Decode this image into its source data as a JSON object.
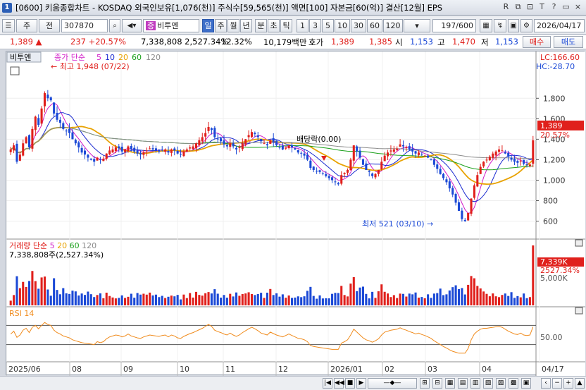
{
  "window": {
    "title": "[0600] 키움종합차트 - KOSDAQ 외국인보유[1,076(천)] 주식수[59,565(천)] 액면[100] 자본금[60(억)] 결산[12월] EPS",
    "controls": [
      "R",
      "⧉",
      "⊡",
      "T",
      "?",
      "▭",
      "×"
    ]
  },
  "toolbar": {
    "stock_type": "주",
    "market": "전",
    "code": "307870",
    "stock_name": "비투엔",
    "periods": [
      "일",
      "주",
      "월",
      "년",
      "분",
      "초",
      "틱"
    ],
    "selected_period": "일",
    "intervals": [
      "1",
      "3",
      "5",
      "10",
      "30",
      "60",
      "120"
    ],
    "count": "197/600",
    "date": "2026/04/17"
  },
  "quote": {
    "price": "1,389 ▲",
    "change": "237 +20.57%",
    "volume_amount": "7,338,808 2,527.34%",
    "turnover": "12.32%",
    "trade_value": "10,179백만",
    "ask_label": "호가",
    "ask": "1,389",
    "bid": "1,385",
    "open_label": "시",
    "open": "1,153",
    "high_label": "고",
    "high": "1,470",
    "low_label": "저",
    "low": "1,153",
    "buy_label": "매수",
    "sell_label": "매도"
  },
  "chart_legend": {
    "stock_name": "비투엔",
    "ma_label": "종가 단순",
    "ma_periods": [
      "5",
      "10",
      "20",
      "60",
      "120"
    ],
    "lc": "LC:166.60",
    "hc": "HC:-28.70",
    "vol_label": "거래량 단순",
    "vol_ma": [
      "5",
      "20",
      "60",
      "120"
    ],
    "vol_info": "7,338,808주(2,527.34%)",
    "rsi_label": "RSI 14",
    "annot_high": "최고 1,948 (07/22)",
    "annot_low": "최저 521 (03/10)",
    "annot_div": "배당락(0.00)",
    "price_tag": "1,389",
    "pct_tag": "20.57%",
    "vol_tag": "7,339K",
    "vol_pct_tag": "2527.34%"
  },
  "colors": {
    "up": "#e0201c",
    "down": "#1b49d6",
    "ma5": "#d21cc8",
    "ma10": "#1a2ad0",
    "ma20": "#e8a200",
    "ma60": "#1aa01a",
    "ma120": "#8c8c8c",
    "rsi": "#f08b1c"
  },
  "chart_data": {
    "type": "candlestick",
    "price_axis": {
      "ticks": [
        "1,800",
        "1,600",
        "1,400",
        "1,200",
        "1,000",
        "800",
        "600"
      ],
      "range": [
        480,
        2050
      ]
    },
    "volume_axis": {
      "ticks": [
        "5,000K"
      ]
    },
    "rsi_axis": {
      "ticks": [
        "50.00"
      ]
    },
    "x_ticks": [
      "2025/06",
      "08",
      "09",
      "10",
      "11",
      "12",
      "2026/01",
      "02",
      "03",
      "04",
      "04/17"
    ],
    "close_series": [
      1300,
      1340,
      1180,
      1250,
      1360,
      1420,
      1320,
      1500,
      1620,
      1540,
      1700,
      1850,
      1800,
      1780,
      1650,
      1590,
      1560,
      1500,
      1480,
      1460,
      1400,
      1360,
      1320,
      1270,
      1250,
      1220,
      1200,
      1180,
      1220,
      1200,
      1210,
      1260,
      1290,
      1300,
      1320,
      1310,
      1280,
      1300,
      1330,
      1300,
      1280,
      1260,
      1250,
      1270,
      1290,
      1310,
      1300,
      1290,
      1280,
      1290,
      1300,
      1270,
      1300,
      1290,
      1260,
      1250,
      1280,
      1300,
      1320,
      1330,
      1360,
      1390,
      1420,
      1460,
      1520,
      1490,
      1420,
      1400,
      1380,
      1350,
      1330,
      1360,
      1330,
      1300,
      1320,
      1360,
      1400,
      1440,
      1470,
      1450,
      1420,
      1380,
      1360,
      1340,
      1390,
      1370,
      1340,
      1320,
      1300,
      1320,
      1340,
      1320,
      1300,
      1270,
      1260,
      1240,
      1200,
      1120,
      1100,
      1090,
      1080,
      1060,
      1040,
      1020,
      1000,
      980,
      960,
      1050,
      1070,
      1100,
      1200,
      1340,
      1280,
      1220,
      1150,
      1100,
      1080,
      1040,
      1060,
      1100,
      1180,
      1240,
      1270,
      1290,
      1300,
      1310,
      1350,
      1330,
      1320,
      1300,
      1280,
      1260,
      1270,
      1250,
      1240,
      1220,
      1200,
      1150,
      1110,
      1060,
      1020,
      980,
      920,
      860,
      780,
      700,
      620,
      600,
      680,
      820,
      950,
      1050,
      1130,
      1180,
      1200,
      1230,
      1260,
      1280,
      1300,
      1290,
      1260,
      1230,
      1200,
      1180,
      1170,
      1190,
      1160,
      1150,
      1153,
      1389
    ],
    "rsi_series": [
      52,
      58,
      45,
      50,
      60,
      64,
      55,
      66,
      70,
      63,
      70,
      76,
      72,
      70,
      60,
      55,
      52,
      48,
      46,
      44,
      40,
      38,
      36,
      34,
      33,
      32,
      31,
      30,
      36,
      34,
      36,
      42,
      46,
      48,
      50,
      49,
      46,
      48,
      52,
      48,
      46,
      44,
      43,
      46,
      48,
      50,
      49,
      48,
      47,
      49,
      50,
      46,
      50,
      48,
      44,
      43,
      47,
      50,
      53,
      55,
      58,
      61,
      64,
      68,
      72,
      68,
      60,
      57,
      55,
      52,
      50,
      54,
      50,
      47,
      50,
      55,
      59,
      63,
      66,
      63,
      59,
      54,
      52,
      50,
      56,
      53,
      50,
      48,
      46,
      49,
      52,
      49,
      46,
      43,
      42,
      40,
      36,
      28,
      26,
      25,
      24,
      23,
      22,
      21,
      20,
      20,
      20,
      33,
      36,
      40,
      50,
      62,
      56,
      50,
      44,
      40,
      38,
      35,
      38,
      42,
      50,
      56,
      58,
      60,
      61,
      62,
      65,
      62,
      60,
      57,
      55,
      52,
      54,
      51,
      49,
      46,
      43,
      38,
      34,
      30,
      26,
      23,
      19,
      16,
      14,
      12,
      12,
      12,
      22,
      40,
      52,
      58,
      62,
      64,
      64,
      65,
      66,
      67,
      68,
      66,
      62,
      58,
      55,
      52,
      51,
      54,
      50,
      49,
      50,
      67
    ]
  }
}
